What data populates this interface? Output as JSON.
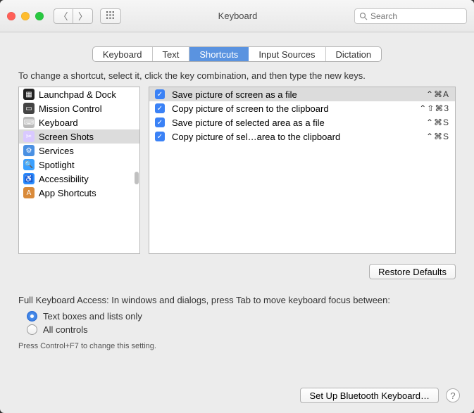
{
  "window": {
    "title": "Keyboard"
  },
  "search": {
    "placeholder": "Search"
  },
  "tabs": [
    "Keyboard",
    "Text",
    "Shortcuts",
    "Input Sources",
    "Dictation"
  ],
  "active_tab": 2,
  "instruction": "To change a shortcut, select it, click the key combination, and then type the new keys.",
  "categories": [
    {
      "label": "Launchpad & Dock",
      "icon_bg": "#222",
      "glyph": "▦"
    },
    {
      "label": "Mission Control",
      "icon_bg": "#444",
      "glyph": "▭"
    },
    {
      "label": "Keyboard",
      "icon_bg": "#bbb",
      "glyph": "⌨"
    },
    {
      "label": "Screen Shots",
      "icon_bg": "#d9c9ff",
      "glyph": "✂"
    },
    {
      "label": "Services",
      "icon_bg": "#4a90e2",
      "glyph": "⚙"
    },
    {
      "label": "Spotlight",
      "icon_bg": "#3aa0ff",
      "glyph": "🔍"
    },
    {
      "label": "Accessibility",
      "icon_bg": "#2a8cff",
      "glyph": "♿"
    },
    {
      "label": "App Shortcuts",
      "icon_bg": "#d98a3a",
      "glyph": "A"
    }
  ],
  "selected_category": 3,
  "shortcuts": [
    {
      "enabled": true,
      "label": "Save picture of screen as a file",
      "keys": "⌃⌘A"
    },
    {
      "enabled": true,
      "label": "Copy picture of screen to the clipboard",
      "keys": "⌃⇧⌘3"
    },
    {
      "enabled": true,
      "label": "Save picture of selected area as a file",
      "keys": "⌃⌘S"
    },
    {
      "enabled": true,
      "label": "Copy picture of sel…area to the clipboard",
      "keys": "⌃⌘S"
    }
  ],
  "selected_shortcut": 0,
  "restore_label": "Restore Defaults",
  "access": {
    "heading": "Full Keyboard Access: In windows and dialogs, press Tab to move keyboard focus between:",
    "options": [
      "Text boxes and lists only",
      "All controls"
    ],
    "selected": 0,
    "hint": "Press Control+F7 to change this setting."
  },
  "footer_button": "Set Up Bluetooth Keyboard…",
  "help_glyph": "?"
}
